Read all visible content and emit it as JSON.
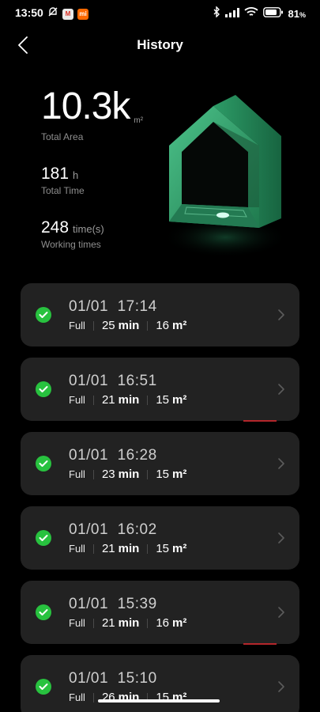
{
  "status_bar": {
    "time": "13:50",
    "battery": "81",
    "battery_unit": "%",
    "icons": [
      "do-not-disturb-icon",
      "gmail-icon",
      "mi-app-icon",
      "bluetooth-icon",
      "signal-icon",
      "wifi-icon",
      "battery-icon"
    ],
    "gmail_letter": "M",
    "mi_letter": "mi"
  },
  "header": {
    "title": "History",
    "back_icon": "back-chevron-icon"
  },
  "summary": {
    "total_area_value": "10.3k",
    "total_area_unit": "m²",
    "total_area_label": "Total Area",
    "total_time_value": "181",
    "total_time_unit": "h",
    "total_time_label": "Total Time",
    "working_times_value": "248",
    "working_times_unit": "time(s)",
    "working_times_label": "Working times"
  },
  "history": [
    {
      "date": "01/01",
      "time": "17:14",
      "mode": "Full",
      "duration_value": "25",
      "duration_unit": "min",
      "area_value": "16",
      "area_unit": "m²"
    },
    {
      "date": "01/01",
      "time": "16:51",
      "mode": "Full",
      "duration_value": "21",
      "duration_unit": "min",
      "area_value": "15",
      "area_unit": "m²"
    },
    {
      "date": "01/01",
      "time": "16:28",
      "mode": "Full",
      "duration_value": "23",
      "duration_unit": "min",
      "area_value": "15",
      "area_unit": "m²"
    },
    {
      "date": "01/01",
      "time": "16:02",
      "mode": "Full",
      "duration_value": "21",
      "duration_unit": "min",
      "area_value": "15",
      "area_unit": "m²"
    },
    {
      "date": "01/01",
      "time": "15:39",
      "mode": "Full",
      "duration_value": "21",
      "duration_unit": "min",
      "area_value": "16",
      "area_unit": "m²"
    },
    {
      "date": "01/01",
      "time": "15:10",
      "mode": "Full",
      "duration_value": "26",
      "duration_unit": "min",
      "area_value": "15",
      "area_unit": "m²"
    }
  ],
  "colors": {
    "background": "#000000",
    "card": "#222222",
    "accent_green": "#28c23f",
    "device_green": "#2f9e68"
  }
}
